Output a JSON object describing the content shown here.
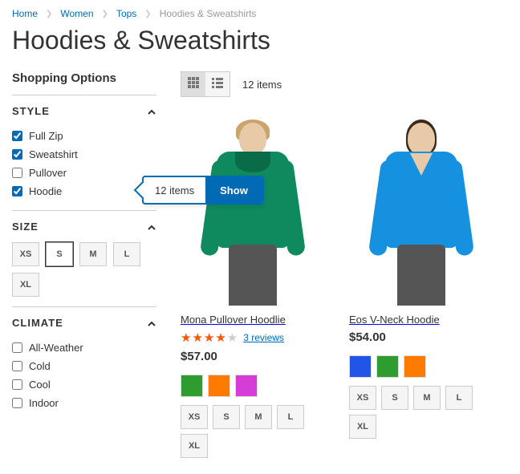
{
  "breadcrumb": {
    "items": [
      {
        "label": "Home"
      },
      {
        "label": "Women"
      },
      {
        "label": "Tops"
      }
    ],
    "current": "Hoodies & Sweatshirts"
  },
  "page_title": "Hoodies & Sweatshirts",
  "sidebar": {
    "title": "Shopping Options",
    "filters": {
      "style": {
        "title": "STYLE",
        "options": [
          {
            "label": "Full Zip",
            "checked": true
          },
          {
            "label": "Sweatshirt",
            "checked": true
          },
          {
            "label": "Pullover",
            "checked": false
          },
          {
            "label": "Hoodie",
            "checked": true
          }
        ]
      },
      "size": {
        "title": "SIZE",
        "options": [
          {
            "label": "XS",
            "selected": false
          },
          {
            "label": "S",
            "selected": true
          },
          {
            "label": "M",
            "selected": false
          },
          {
            "label": "L",
            "selected": false
          },
          {
            "label": "XL",
            "selected": false
          }
        ]
      },
      "climate": {
        "title": "CLIMATE",
        "options": [
          {
            "label": "All-Weather",
            "checked": false
          },
          {
            "label": "Cold",
            "checked": false
          },
          {
            "label": "Cool",
            "checked": false
          },
          {
            "label": "Indoor",
            "checked": false
          }
        ]
      }
    }
  },
  "toolbar": {
    "count": "12 items"
  },
  "tooltip": {
    "text": "12 items",
    "button": "Show"
  },
  "products": [
    {
      "name": "Mona Pullover Hoodlie",
      "reviews_label": "3 reviews",
      "rating_pct": 80,
      "price": "$57.00",
      "colors": [
        "#2e9c2e",
        "#ff7b00",
        "#d63cd6"
      ],
      "sizes": [
        "XS",
        "S",
        "M",
        "L",
        "XL"
      ]
    },
    {
      "name": "Eos V-Neck Hoodie",
      "price": "$54.00",
      "colors": [
        "#2254e8",
        "#2e9c2e",
        "#ff7b00"
      ],
      "sizes": [
        "XS",
        "S",
        "M",
        "L",
        "XL"
      ]
    }
  ]
}
